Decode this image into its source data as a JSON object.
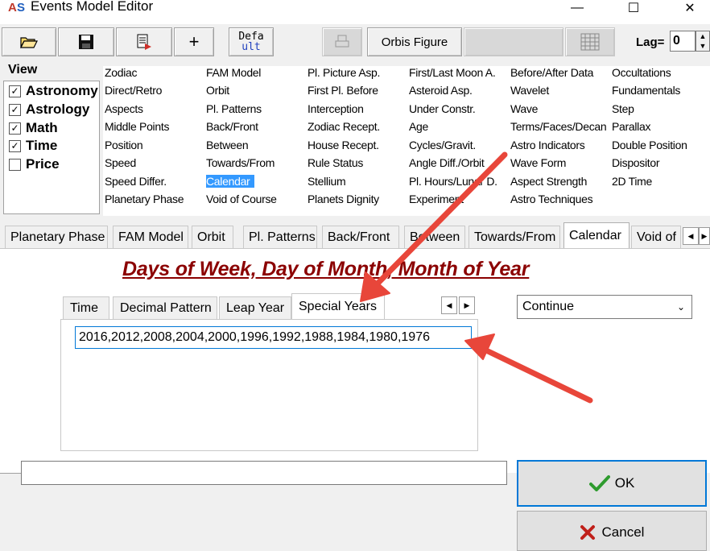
{
  "window": {
    "title": "Events Model Editor",
    "minimize_glyph": "—",
    "maximize_glyph": "☐",
    "close_glyph": "✕"
  },
  "toolbar": {
    "open_icon": "folder-open-icon",
    "save_icon": "floppy-disk-icon",
    "export_icon": "export-document-icon",
    "add_icon": "+",
    "default_label": "Defa ult",
    "default_label_line1": "Defa",
    "default_label_line2": "ult",
    "orbis_figure_label": "Orbis Figure",
    "lag_label": "Lag=",
    "lag_value": "0"
  },
  "view": {
    "title": "View",
    "items": [
      {
        "label": "Astronomy",
        "checked": true,
        "mark": "✓"
      },
      {
        "label": "Astrology",
        "checked": true,
        "mark": "✓"
      },
      {
        "label": "Math",
        "checked": true,
        "mark": "✓"
      },
      {
        "label": "Time",
        "checked": true,
        "mark": "✓"
      },
      {
        "label": "Price",
        "checked": false,
        "mark": ""
      }
    ]
  },
  "model_columns": [
    [
      "Zodiac",
      "Direct/Retro",
      "Aspects",
      "Middle Points",
      "Position",
      "Speed",
      "Speed Differ.",
      "Planetary Phase"
    ],
    [
      "FAM Model",
      "Orbit",
      "Pl. Patterns",
      "Back/Front",
      "Between",
      "Towards/From",
      "Calendar",
      "Void of Course"
    ],
    [
      "Pl. Picture Asp.",
      "First Pl. Before",
      "Interception",
      "Zodiac Recept.",
      "House Recept.",
      "Rule Status",
      "Stellium",
      "Planets Dignity"
    ],
    [
      "First/Last Moon A.",
      "Asteroid Asp.",
      "Under Constr.",
      "Age",
      "Cycles/Gravit.",
      "Angle Diff./Orbit",
      "Pl. Hours/Lunar D.",
      "Experiment"
    ],
    [
      "Before/After Data",
      "Wavelet",
      "Wave",
      "Terms/Faces/Decan",
      "Astro Indicators",
      "Wave Form",
      "Aspect Strength",
      "Astro Techniques"
    ],
    [
      "Occultations",
      "Fundamentals",
      "Step",
      "Parallax",
      "Double Position",
      "Dispositor",
      "2D Time"
    ]
  ],
  "selected_model": "Calendar",
  "tabs": [
    "Planetary Phase",
    "FAM Model",
    "Orbit",
    "Pl. Patterns",
    "Back/Front",
    "Between",
    "Towards/From",
    "Calendar",
    "Void of ("
  ],
  "active_tab": "Calendar",
  "calendar": {
    "title": "Days of Week, Day of Month, Month of Year",
    "inner_tabs": [
      "Time",
      "Decimal Pattern",
      "Leap Year",
      "Special Years"
    ],
    "active_inner_tab": "Special Years",
    "special_years_value": "2016,2012,2008,2004,2000,1996,1992,1988,1984,1980,1976",
    "mode_select_value": "Continue"
  },
  "buttons": {
    "ok_label": "OK",
    "cancel_label": "Cancel",
    "ok_icon": "check-icon",
    "cancel_icon": "x-icon"
  },
  "colors": {
    "accent": "#0078d7",
    "selection": "#3399ff",
    "title_red": "#8b0000",
    "annotation_arrow": "#e8463a"
  }
}
